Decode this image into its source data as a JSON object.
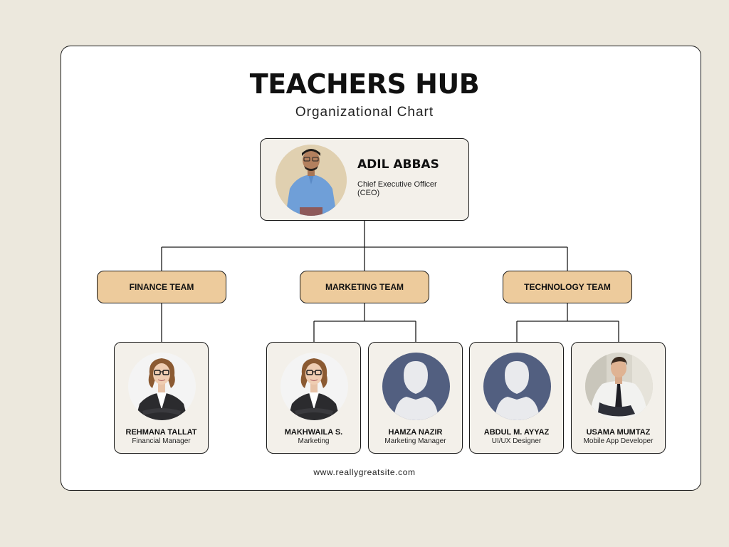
{
  "header": {
    "title": "TEACHERS HUB",
    "subtitle": "Organizational Chart"
  },
  "ceo": {
    "name": "ADIL ABBAS",
    "role": "Chief Executive Officer (CEO)"
  },
  "teams": [
    {
      "label": "FINANCE TEAM"
    },
    {
      "label": "MARKETING TEAM"
    },
    {
      "label": "TECHNOLOGY TEAM"
    }
  ],
  "members": [
    {
      "name": "REHMANA TALLAT",
      "role": "Financial Manager",
      "photo": "woman-photo"
    },
    {
      "name": "MAKHWAILA S.",
      "role": "Marketing",
      "photo": "woman-photo"
    },
    {
      "name": "HAMZA NAZIR",
      "role": "Marketing Manager",
      "photo": "avatar-placeholder-icon"
    },
    {
      "name": "ABDUL M. AYYAZ",
      "role": "UI/UX Designer",
      "photo": "avatar-placeholder-icon"
    },
    {
      "name": "USAMA MUMTAZ",
      "role": "Mobile App Developer",
      "photo": "man-photo"
    }
  ],
  "footer": {
    "website": "www.reallygreatsite.com"
  },
  "colors": {
    "background": "#ece8dd",
    "card": "#ffffff",
    "box": "#f3f0ea",
    "team": "#edcb9c",
    "avatar": "#525f80"
  }
}
